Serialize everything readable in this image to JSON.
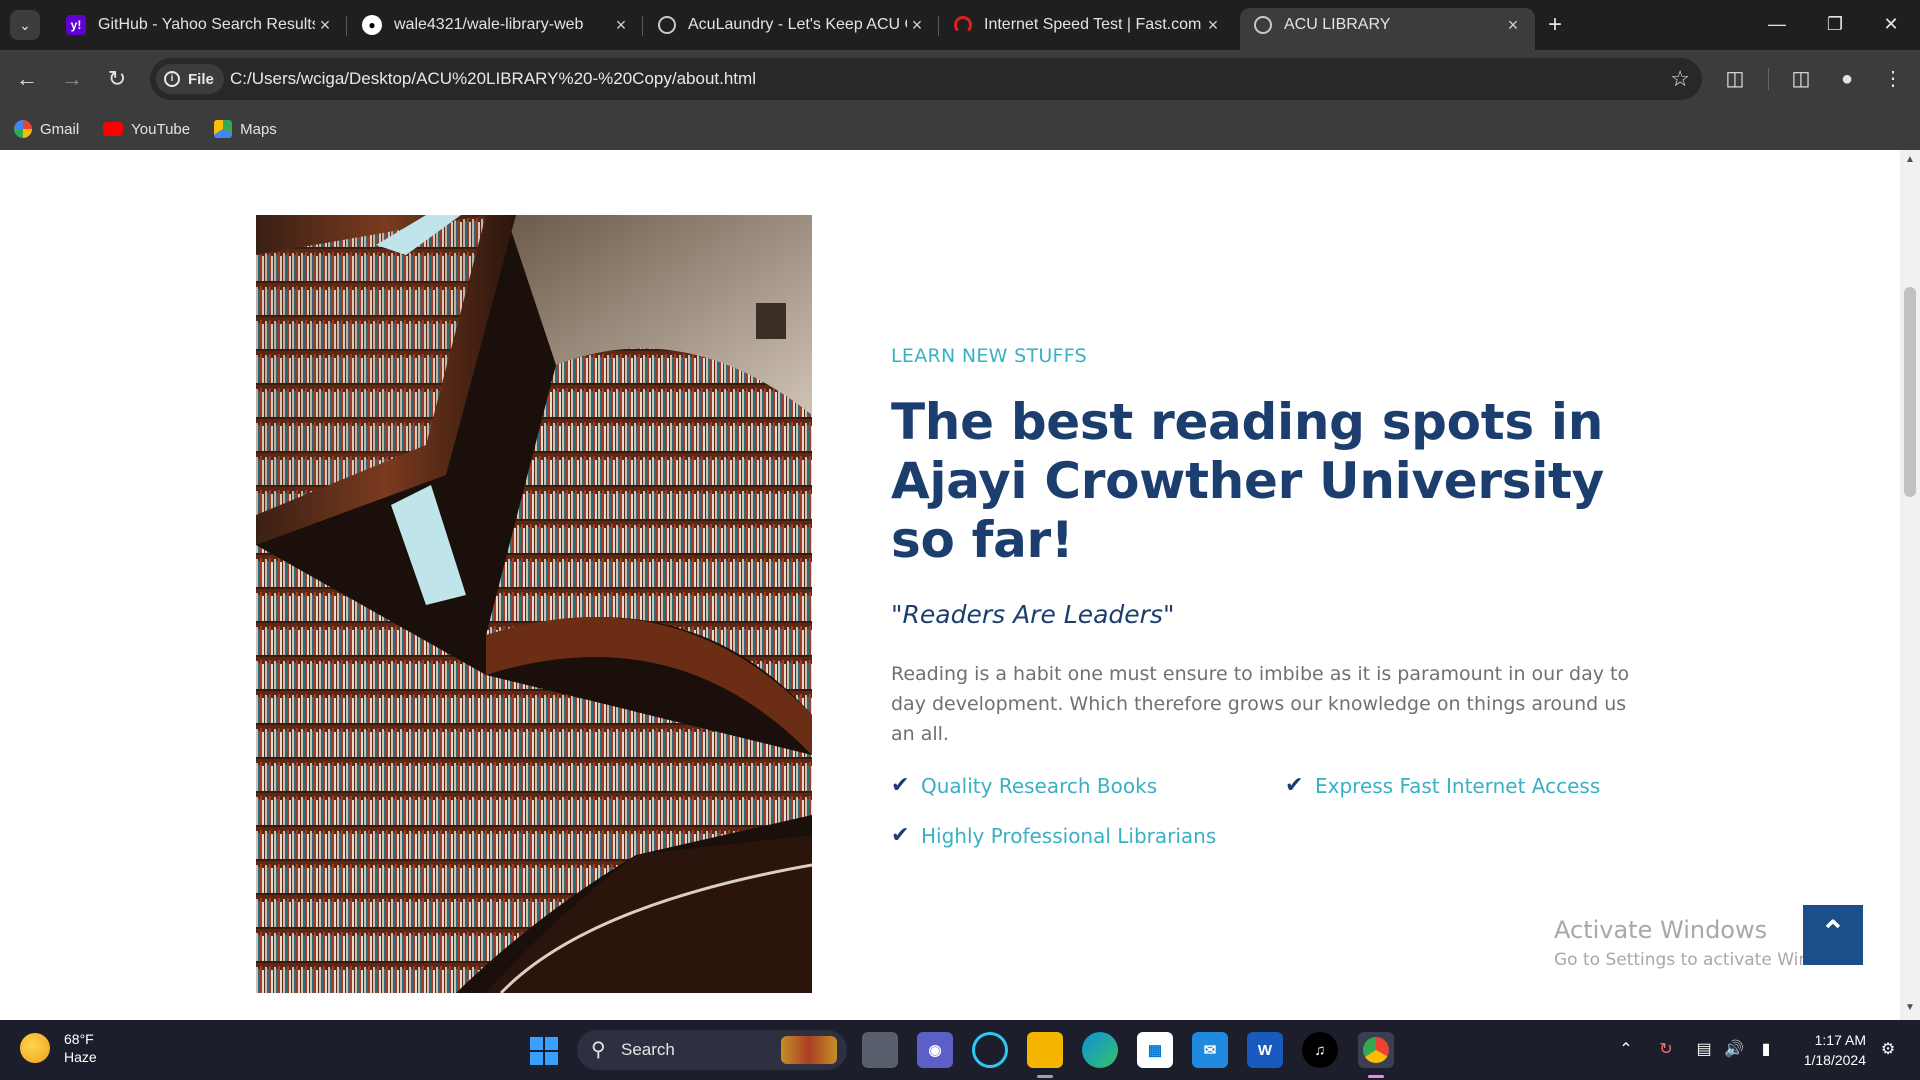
{
  "browser": {
    "tabs": [
      {
        "title": "GitHub - Yahoo Search Results",
        "icon": "yahoo-icon",
        "active": false
      },
      {
        "title": "wale4321/wale-library-web",
        "icon": "github-icon",
        "active": false
      },
      {
        "title": "AcuLaundry - Let's Keep ACU Cl",
        "icon": "globe-icon",
        "active": false
      },
      {
        "title": "Internet Speed Test | Fast.com",
        "icon": "fast-icon",
        "active": false
      },
      {
        "title": "ACU LIBRARY",
        "icon": "globe-icon",
        "active": true
      }
    ],
    "address": {
      "scheme_chip": "File",
      "url": "C:/Users/wciga/Desktop/ACU%20LIBRARY%20-%20Copy/about.html"
    },
    "bookmarks": [
      {
        "label": "Gmail",
        "icon": "google-icon"
      },
      {
        "label": "YouTube",
        "icon": "youtube-icon"
      },
      {
        "label": "Maps",
        "icon": "maps-icon"
      }
    ]
  },
  "page": {
    "eyebrow": "LEARN NEW STUFFS",
    "headline": "The best reading spots in Ajayi Crowther University so far!",
    "quote": "\"Readers Are Leaders\"",
    "body": "Reading is a habit one must ensure to imbibe as it is paramount in our day to day development. Which therefore grows our knowledge on things around us an all.",
    "features": [
      "Quality Research Books",
      "Express Fast Internet Access",
      "Highly Professional Librarians"
    ],
    "back_to_top_icon": "double-chevron-up-icon",
    "image_alt": "library-bookshelves-image"
  },
  "watermark": {
    "line1": "Activate Windows",
    "line2": "Go to Settings to activate Windows."
  },
  "taskbar": {
    "weather_temp": "68°F",
    "weather_desc": "Haze",
    "search_label": "Search",
    "time": "1:17 AM",
    "date": "1/18/2024"
  },
  "colors": {
    "accent_teal": "#39b0c4",
    "heading_navy": "#1b3e6f",
    "back_to_top": "#1b4f8c"
  }
}
